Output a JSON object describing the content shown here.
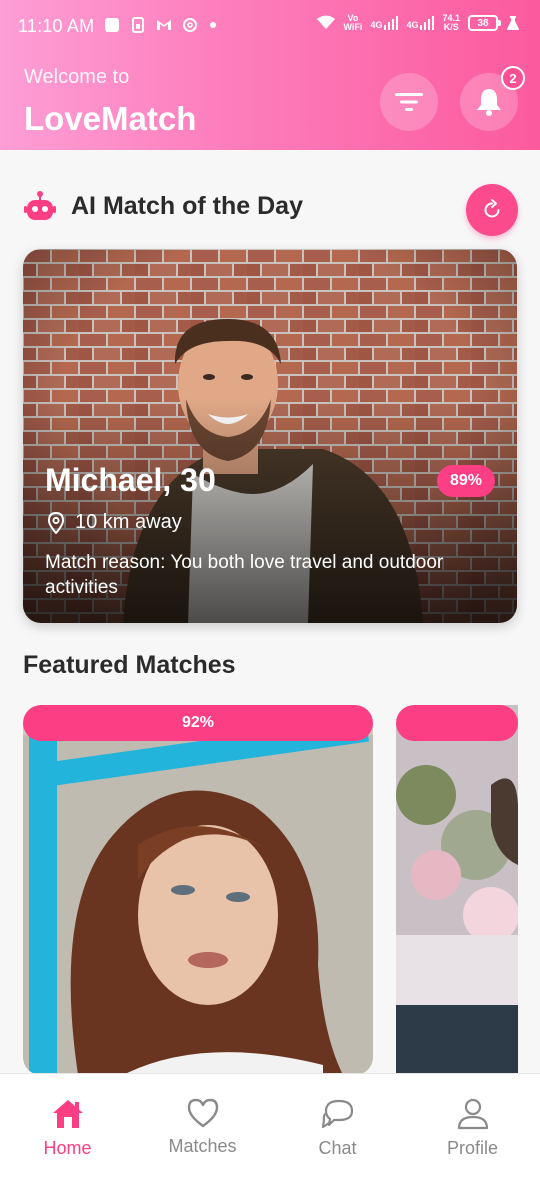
{
  "status_bar": {
    "time": "11:10 AM",
    "vo_top": "Vo",
    "vo_bottom": "WiFi",
    "net1": "4G",
    "net2": "4G",
    "speed_top": "74.1",
    "speed_bottom": "K/S",
    "battery": "38"
  },
  "header": {
    "welcome": "Welcome to",
    "app_name": "LoveMatch",
    "notification_count": "2"
  },
  "ai_match": {
    "section_title": "AI Match of the Day",
    "name_age": "Michael, 30",
    "match_percent": "89%",
    "distance": "10 km away",
    "reason": "Match reason: You both love travel and outdoor activities"
  },
  "featured": {
    "section_title": "Featured Matches",
    "cards": [
      {
        "match_percent": "92%"
      },
      {
        "match_percent": ""
      }
    ]
  },
  "nav": {
    "items": [
      {
        "label": "Home",
        "icon": "home-icon",
        "active": true
      },
      {
        "label": "Matches",
        "icon": "heart-icon",
        "active": false
      },
      {
        "label": "Chat",
        "icon": "chat-icon",
        "active": false
      },
      {
        "label": "Profile",
        "icon": "person-icon",
        "active": false
      }
    ]
  },
  "colors": {
    "accent": "#fc3e85",
    "header_start": "#fd9ed6",
    "header_end": "#fc5a9e",
    "inactive_nav": "#8a8a8a"
  }
}
